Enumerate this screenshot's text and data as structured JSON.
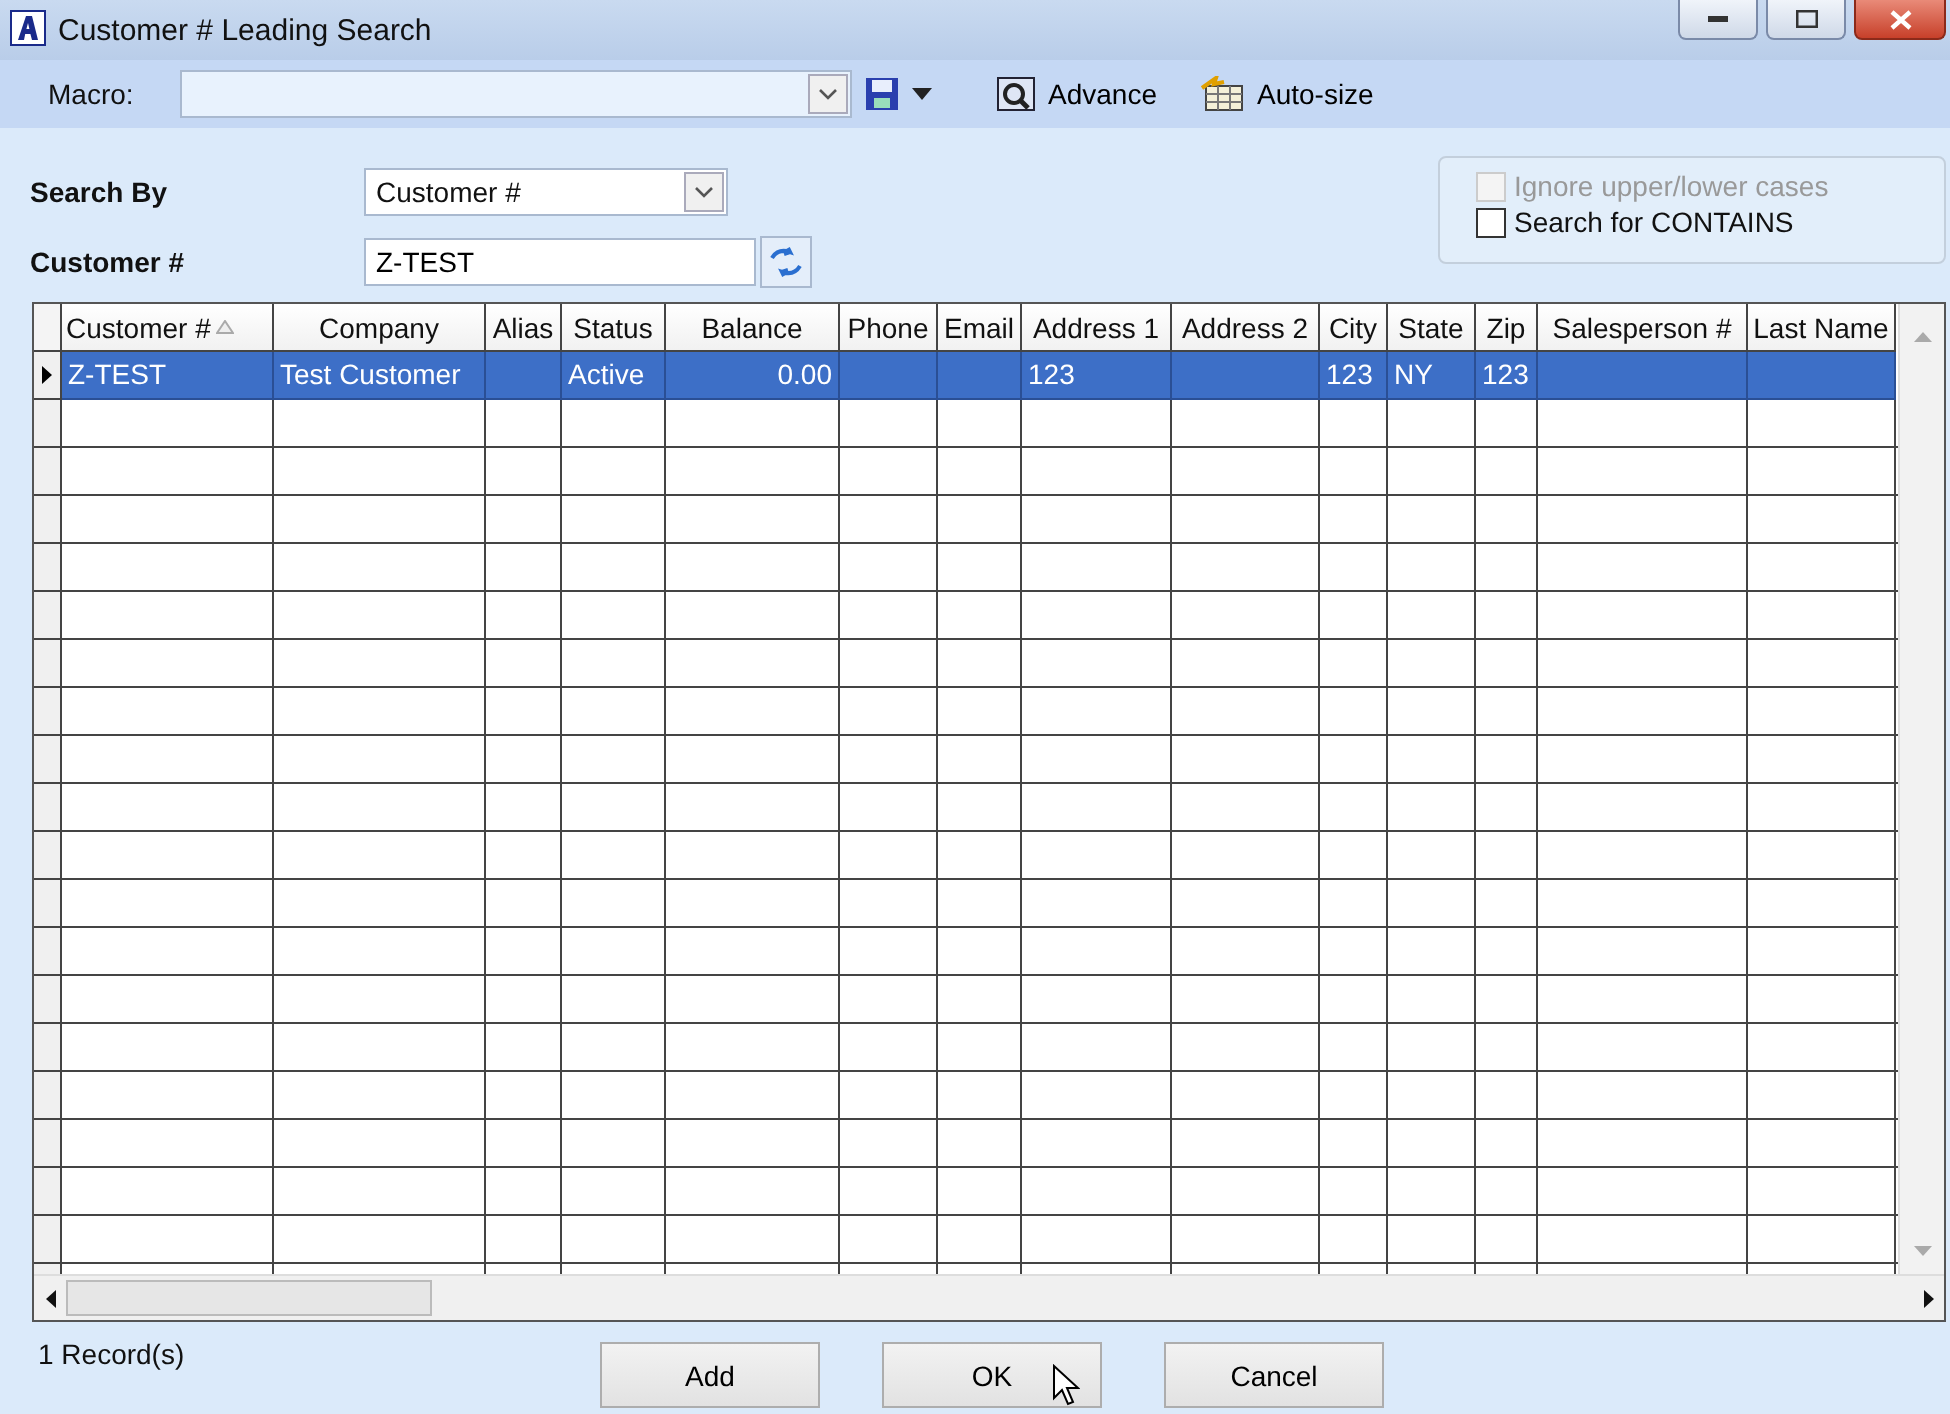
{
  "window": {
    "title": "Customer # Leading Search"
  },
  "toolbar": {
    "macro_label": "Macro:",
    "buttons": [
      {
        "label": "Advance",
        "kind": "advance"
      },
      {
        "label": "Auto-size",
        "kind": "autosize"
      }
    ]
  },
  "search": {
    "search_by_label": "Search By",
    "search_by_value": "Customer #",
    "field_label": "Customer #",
    "field_value": "Z-TEST",
    "options": [
      {
        "label": "Ignore upper/lower cases",
        "checked": false,
        "disabled": true
      },
      {
        "label": "Search for CONTAINS",
        "checked": false,
        "disabled": false
      }
    ]
  },
  "table": {
    "columns": [
      {
        "label": "Customer #",
        "sorted": true,
        "kind": "text"
      },
      {
        "label": "Company",
        "sorted": false,
        "kind": "text"
      },
      {
        "label": "Alias",
        "sorted": false,
        "kind": "text"
      },
      {
        "label": "Status",
        "sorted": false,
        "kind": "text"
      },
      {
        "label": "Balance",
        "sorted": false,
        "kind": "number"
      },
      {
        "label": "Phone",
        "sorted": false,
        "kind": "text"
      },
      {
        "label": "Email",
        "sorted": false,
        "kind": "text"
      },
      {
        "label": "Address 1",
        "sorted": false,
        "kind": "text"
      },
      {
        "label": "Address 2",
        "sorted": false,
        "kind": "text"
      },
      {
        "label": "City",
        "sorted": false,
        "kind": "text"
      },
      {
        "label": "State",
        "sorted": false,
        "kind": "text"
      },
      {
        "label": "Zip",
        "sorted": false,
        "kind": "text"
      },
      {
        "label": "Salesperson #",
        "sorted": false,
        "kind": "text"
      },
      {
        "label": "Last Name",
        "sorted": false,
        "kind": "text"
      }
    ],
    "rows": [
      {
        "selected": true,
        "cells": [
          "Z-TEST",
          "Test Customer",
          "",
          "Active",
          "0.00",
          "",
          "",
          "123",
          "",
          "123",
          "NY",
          "123",
          "",
          ""
        ]
      }
    ]
  },
  "status_bar": {
    "record_count": "1 Record(s)",
    "buttons": [
      "Add",
      "OK",
      "Cancel"
    ]
  }
}
